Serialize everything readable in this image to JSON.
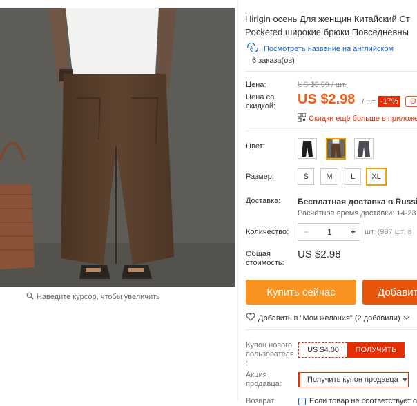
{
  "product": {
    "title_line1": "Hirigin осень Для женщин Китайский Ст",
    "title_line2": "Pocketed широкие брюки Повседневны",
    "translate_link": "Посмотреть название на английском",
    "orders": "6 заказа(ов)"
  },
  "image": {
    "zoom_hint": "Наведите курсор, чтобы увеличить"
  },
  "price": {
    "label": "Цена:",
    "old": "US $3.59 / шт.",
    "discount_label": "Цена со скидкой:",
    "current": "US $2.98",
    "per_unit": "/ шт.",
    "discount_badge": "-17%",
    "extra_badge": "О",
    "app_discount": "Скидки ещё больше в приложе"
  },
  "options": {
    "color_label": "Цвет:",
    "colors": [
      "black-pants",
      "brown-pants",
      "gray-pants"
    ],
    "selected_color": "brown-pants",
    "size_label": "Размер:",
    "sizes": [
      "S",
      "M",
      "L",
      "XL"
    ],
    "selected_size": "XL"
  },
  "shipping": {
    "label": "Доставка:",
    "main": "Бесплатная доставка в Russian",
    "time": "Расчётное время доставки: 14-23"
  },
  "quantity": {
    "label": "Количество:",
    "value": "1",
    "minus": "−",
    "plus": "+",
    "available": "шт. (997 шт. в"
  },
  "total": {
    "label": "Общая стоимость:",
    "value": "US $2.98"
  },
  "actions": {
    "buy_now": "Купить сейчас",
    "add_to_cart": "Добавит",
    "wishlist": "Добавить в \"Мои желания\" (2 добавили)"
  },
  "coupons": {
    "new_user_label": "Купон нового пользователя :",
    "new_user_value": "US $4.00",
    "get_button": "ПОЛУЧИТЬ",
    "seller_label": "Акция продавца:",
    "seller_coupon": "Получить купон продавца"
  },
  "returns": {
    "label": "Возврат",
    "text": "Если товар не соответствует о"
  },
  "colors": {
    "accent": "#f25a16",
    "buy": "#f7931e",
    "cart": "#e8560d",
    "red": "#e62e04",
    "link": "#1a66c9",
    "selected": "#f2a200"
  }
}
